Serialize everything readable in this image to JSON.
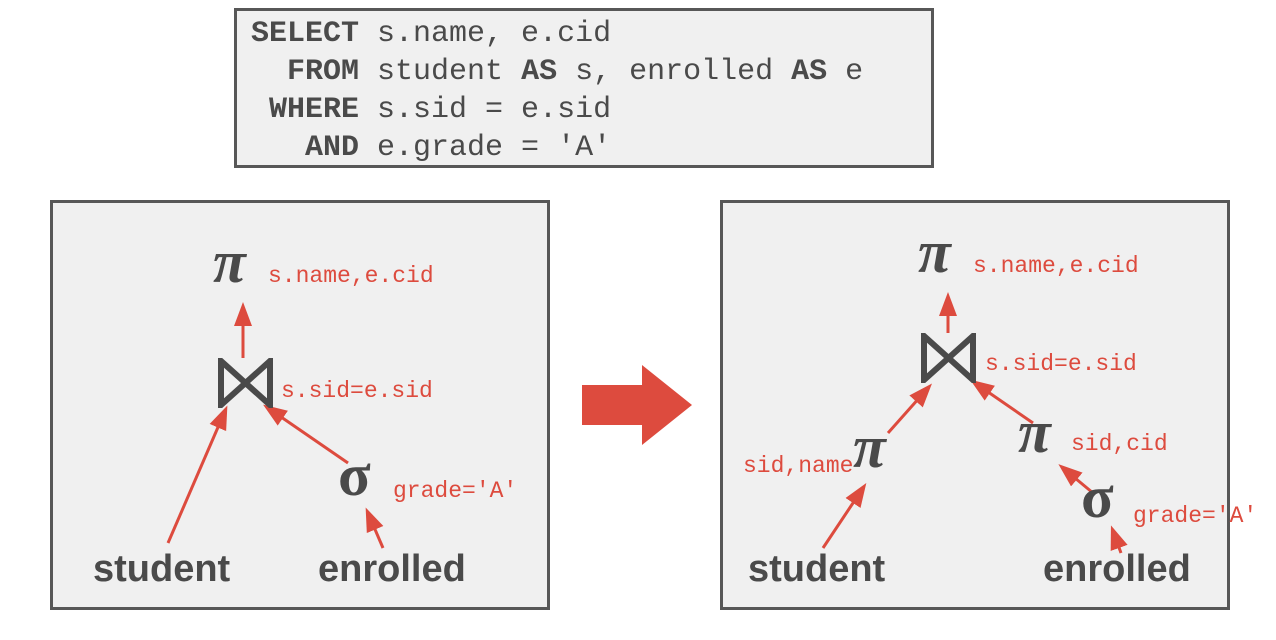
{
  "sql": {
    "kw_select": "SELECT",
    "select_cols": " s.name, e.cid",
    "kw_from": "FROM",
    "from_clause": " student ",
    "kw_as1": "AS",
    "from_s": " s, enrolled ",
    "kw_as2": "AS",
    "from_e": " e",
    "kw_where": "WHERE",
    "where_clause": " s.sid = e.sid",
    "kw_and": "AND",
    "and_clause": " e.grade = 'A'"
  },
  "left_tree": {
    "pi_sub": "s.name,e.cid",
    "join_sub": "s.sid=e.sid",
    "sigma_sub": "grade='A'",
    "rel_student": "student",
    "rel_enrolled": "enrolled"
  },
  "right_tree": {
    "pi_top_sub": "s.name,e.cid",
    "join_sub": "s.sid=e.sid",
    "pi_left_sub": "sid,name",
    "pi_right_sub": "sid,cid",
    "sigma_sub": "grade='A'",
    "rel_student": "student",
    "rel_enrolled": "enrolled"
  },
  "symbols": {
    "pi": "π",
    "sigma": "σ"
  },
  "colors": {
    "accent": "#dd4b3e",
    "box_border": "#575757",
    "box_bg": "#f0f0f0",
    "text": "#4a4a4a"
  }
}
